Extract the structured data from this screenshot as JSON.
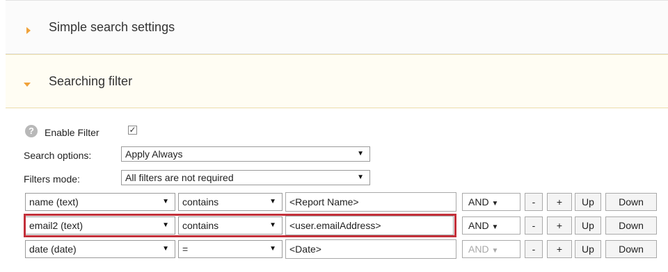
{
  "panels": {
    "simple_search": {
      "title": "Simple search settings",
      "icon": "chevron-right-icon"
    },
    "searching_filter": {
      "title": "Searching filter",
      "icon": "chevron-down-icon"
    }
  },
  "filter": {
    "help_icon": "?",
    "enable_label": "Enable Filter",
    "enable_checked": true,
    "search_options_label": "Search options:",
    "search_options_value": "Apply Always",
    "filters_mode_label": "Filters mode:",
    "filters_mode_value": "All filters are not required"
  },
  "rows": [
    {
      "field": "name (text)",
      "operator": "contains",
      "value": "<Report Name>",
      "logic": "AND",
      "logic_enabled": true
    },
    {
      "field": "email2 (text)",
      "operator": "contains",
      "value": "<user.emailAddress>",
      "logic": "AND",
      "logic_enabled": true
    },
    {
      "field": "date (date)",
      "operator": "=",
      "value": "<Date>",
      "logic": "AND",
      "logic_enabled": false
    }
  ],
  "buttons": {
    "minus": "-",
    "plus": "+",
    "up": "Up",
    "down": "Down"
  },
  "caret": "▼",
  "accent_color": "#f0a23a",
  "highlight_color": "#c3303a"
}
